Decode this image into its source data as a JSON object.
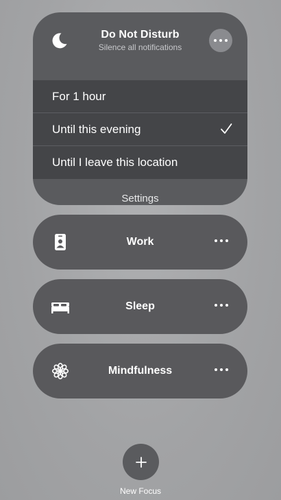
{
  "dnd": {
    "title": "Do Not Disturb",
    "subtitle": "Silence all notifications",
    "options": [
      {
        "label": "For 1 hour",
        "selected": false
      },
      {
        "label": "Until this evening",
        "selected": true
      },
      {
        "label": "Until I leave this location",
        "selected": false
      }
    ],
    "settings_label": "Settings"
  },
  "focus_modes": [
    {
      "label": "Work",
      "icon": "id-badge-icon"
    },
    {
      "label": "Sleep",
      "icon": "bed-icon"
    },
    {
      "label": "Mindfulness",
      "icon": "flower-icon"
    }
  ],
  "new_focus": {
    "label": "New Focus",
    "icon": "plus-icon"
  },
  "colors": {
    "background": "#a8a9ab",
    "card": "#5a5b5e",
    "options_band": "#444548",
    "more_button": "#8a8b8f"
  }
}
